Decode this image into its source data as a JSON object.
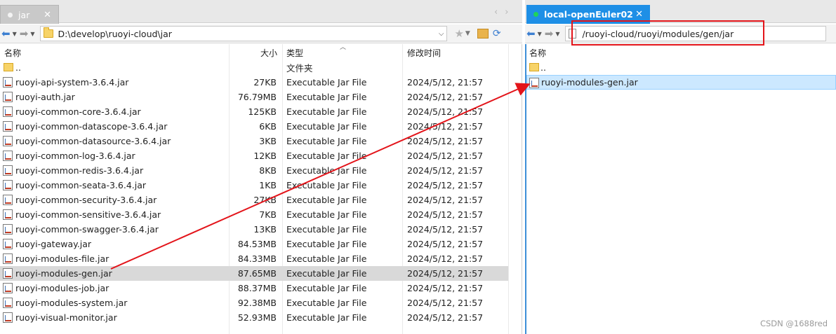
{
  "left_panel": {
    "tab_label": "jar",
    "path": "D:\\develop\\ruoyi-cloud\\jar",
    "headers": {
      "name": "名称",
      "size": "大小",
      "type": "类型",
      "date": "修改时间"
    },
    "parent": {
      "name": "..",
      "type": "文件夹"
    },
    "files": [
      {
        "name": "ruoyi-api-system-3.6.4.jar",
        "size": "27KB",
        "type": "Executable Jar File",
        "date": "2024/5/12, 21:57"
      },
      {
        "name": "ruoyi-auth.jar",
        "size": "76.79MB",
        "type": "Executable Jar File",
        "date": "2024/5/12, 21:57"
      },
      {
        "name": "ruoyi-common-core-3.6.4.jar",
        "size": "125KB",
        "type": "Executable Jar File",
        "date": "2024/5/12, 21:57"
      },
      {
        "name": "ruoyi-common-datascope-3.6.4.jar",
        "size": "6KB",
        "type": "Executable Jar File",
        "date": "2024/5/12, 21:57"
      },
      {
        "name": "ruoyi-common-datasource-3.6.4.jar",
        "size": "3KB",
        "type": "Executable Jar File",
        "date": "2024/5/12, 21:57"
      },
      {
        "name": "ruoyi-common-log-3.6.4.jar",
        "size": "12KB",
        "type": "Executable Jar File",
        "date": "2024/5/12, 21:57"
      },
      {
        "name": "ruoyi-common-redis-3.6.4.jar",
        "size": "8KB",
        "type": "Executable Jar File",
        "date": "2024/5/12, 21:57"
      },
      {
        "name": "ruoyi-common-seata-3.6.4.jar",
        "size": "1KB",
        "type": "Executable Jar File",
        "date": "2024/5/12, 21:57"
      },
      {
        "name": "ruoyi-common-security-3.6.4.jar",
        "size": "27KB",
        "type": "Executable Jar File",
        "date": "2024/5/12, 21:57"
      },
      {
        "name": "ruoyi-common-sensitive-3.6.4.jar",
        "size": "7KB",
        "type": "Executable Jar File",
        "date": "2024/5/12, 21:57"
      },
      {
        "name": "ruoyi-common-swagger-3.6.4.jar",
        "size": "13KB",
        "type": "Executable Jar File",
        "date": "2024/5/12, 21:57"
      },
      {
        "name": "ruoyi-gateway.jar",
        "size": "84.53MB",
        "type": "Executable Jar File",
        "date": "2024/5/12, 21:57"
      },
      {
        "name": "ruoyi-modules-file.jar",
        "size": "84.33MB",
        "type": "Executable Jar File",
        "date": "2024/5/12, 21:57"
      },
      {
        "name": "ruoyi-modules-gen.jar",
        "size": "87.65MB",
        "type": "Executable Jar File",
        "date": "2024/5/12, 21:57",
        "selected": true
      },
      {
        "name": "ruoyi-modules-job.jar",
        "size": "88.37MB",
        "type": "Executable Jar File",
        "date": "2024/5/12, 21:57"
      },
      {
        "name": "ruoyi-modules-system.jar",
        "size": "92.38MB",
        "type": "Executable Jar File",
        "date": "2024/5/12, 21:57"
      },
      {
        "name": "ruoyi-visual-monitor.jar",
        "size": "52.93MB",
        "type": "Executable Jar File",
        "date": "2024/5/12, 21:57"
      }
    ]
  },
  "right_panel": {
    "tab_label": "local-openEuler02",
    "path": "/ruoyi-cloud/ruoyi/modules/gen/jar",
    "headers": {
      "name": "名称"
    },
    "parent": {
      "name": ".."
    },
    "files": [
      {
        "name": "ruoyi-modules-gen.jar",
        "selected": true
      }
    ]
  },
  "watermark": "CSDN @1688red",
  "colors": {
    "accent": "#1e8fe6",
    "annotation": "#e3141a",
    "selected_left": "#d9d9d9",
    "selected_right": "#cce8ff"
  }
}
